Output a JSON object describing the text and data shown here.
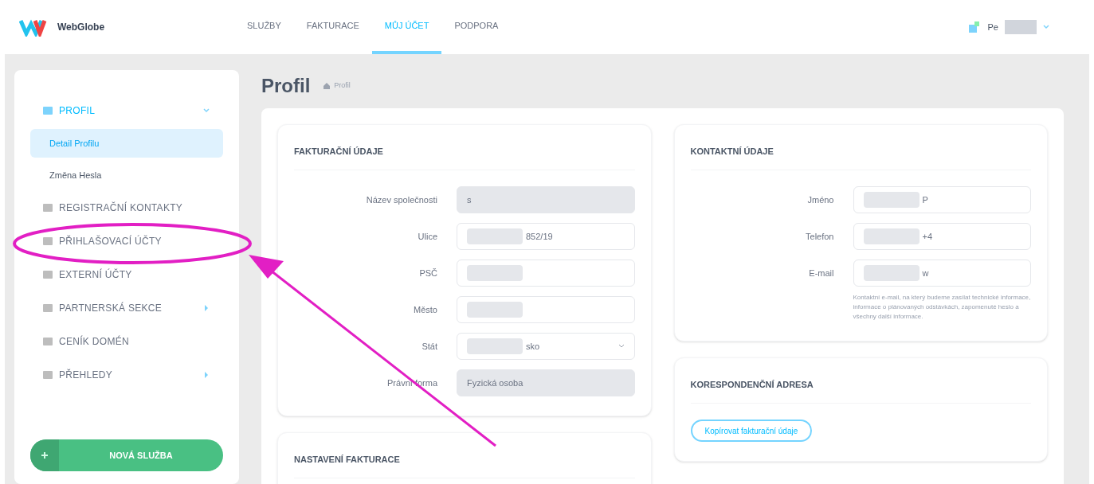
{
  "header": {
    "logo": "WebGlobe",
    "nav": [
      {
        "label": "SLUŽBY",
        "selected": false
      },
      {
        "label": "FAKTURACE",
        "selected": false
      },
      {
        "label": "MŮJ ÚČET",
        "selected": true
      },
      {
        "label": "PODPORA",
        "selected": false
      }
    ],
    "user": "Pe"
  },
  "sidebar": {
    "items": [
      {
        "kind": "group",
        "label": "PROFIL",
        "selected": true,
        "expanded": true,
        "children": [
          {
            "label": "Detail Profilu",
            "selected": true
          },
          {
            "label": "Změna Hesla",
            "selected": false
          }
        ]
      },
      {
        "kind": "link",
        "label": "REGISTRAČNÍ KONTAKTY",
        "selected": false
      },
      {
        "kind": "link",
        "label": "PŘIHLAŠOVACÍ ÚČTY",
        "selected": false
      },
      {
        "kind": "link",
        "label": "EXTERNÍ ÚČTY",
        "selected": false
      },
      {
        "kind": "group",
        "label": "PARTNERSKÁ SEKCE",
        "selected": false,
        "expanded": false
      },
      {
        "kind": "link",
        "label": "CENÍK DOMÉN",
        "selected": false
      },
      {
        "kind": "group",
        "label": "PŘEHLEDY",
        "selected": false,
        "expanded": false
      }
    ],
    "button": "NOVÁ SLUŽBA"
  },
  "page": {
    "title": "Profil",
    "breadcrumb": "Profil"
  },
  "billing": {
    "title": "FAKTURAČNÍ ÚDAJE",
    "fields": [
      {
        "kind": "text",
        "label": "Název společnosti",
        "value": "s",
        "disabled": true
      },
      {
        "kind": "text",
        "label": "Ulice",
        "value": "852/19",
        "disabled": false
      },
      {
        "kind": "text",
        "label": "PSČ",
        "disabled": false
      },
      {
        "kind": "text",
        "label": "Město",
        "disabled": false
      },
      {
        "kind": "select",
        "label": "Stát",
        "value": "sko",
        "disabled": false
      },
      {
        "kind": "text",
        "label": "Právní forma",
        "value": "Fyzická osoba",
        "disabled": true
      }
    ]
  },
  "contact": {
    "title": "KONTAKTNÍ ÚDAJE",
    "fields": [
      {
        "kind": "text",
        "label": "Jméno",
        "value": "P",
        "disabled": false
      },
      {
        "kind": "text",
        "label": "Telefon",
        "value": "+4",
        "disabled": false
      },
      {
        "kind": "text",
        "label": "E-mail",
        "value": "w",
        "disabled": false
      }
    ],
    "help": "Kontaktní e-mail, na který budeme zasílat technické informace, informace o plánovaných odstávkách, zapomenuté heslo a všechny další informace."
  },
  "correspondence": {
    "title": "KORESPONDENČNÍ ADRESA",
    "button": "Kopírovat fakturační údaje"
  },
  "billing_settings": {
    "title": "NASTAVENÍ FAKTURACE"
  }
}
